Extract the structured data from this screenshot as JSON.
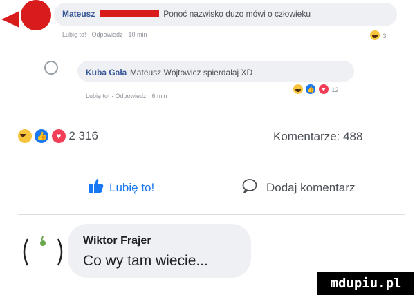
{
  "comment1": {
    "author": "Mateusz",
    "text": "Ponoć nazwisko dużo mówi o człowieku",
    "meta": "Lubię to! · Odpowiedz · 10 min",
    "reaction_count": "3"
  },
  "comment2": {
    "author": "Kuba Gała",
    "text": "Mateusz Wójtowicz spierdalaj XD",
    "meta": "Lubię to! · Odpowiedz · 6 min",
    "reaction_count": "12"
  },
  "stats": {
    "reaction_count": "2 316",
    "comments_label": "Komentarze: 488"
  },
  "actions": {
    "like_label": "Lubię to!",
    "comment_label": "Dodaj komentarz"
  },
  "comment3": {
    "author": "Wiktor Frajer",
    "text": "Co wy tam wiecie..."
  },
  "watermark": "mdupiu.pl",
  "colors": {
    "like_blue": "#1877f2",
    "link_blue": "#385898",
    "redaction": "#d81c1c",
    "bubble_bg": "#eef0f3"
  }
}
